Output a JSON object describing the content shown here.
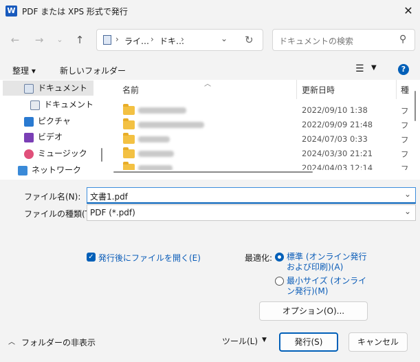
{
  "window": {
    "title": "PDF または XPS 形式で発行",
    "app_icon": "W"
  },
  "nav": {
    "breadcrumb": [
      "ライ…",
      "ドキ…"
    ],
    "search_placeholder": "ドキュメントの検索"
  },
  "toolbar": {
    "organize": "整理 ▾",
    "new_folder": "新しいフォルダー"
  },
  "sidebar": {
    "items": [
      {
        "label": "ドキュメント",
        "icon": "document-icon"
      },
      {
        "label": "ドキュメント",
        "icon": "document-icon"
      },
      {
        "label": "ピクチャ",
        "icon": "pictures-icon"
      },
      {
        "label": "ビデオ",
        "icon": "video-icon"
      },
      {
        "label": "ミュージック",
        "icon": "music-icon"
      },
      {
        "label": "ネットワーク",
        "icon": "network-icon"
      }
    ]
  },
  "filelist": {
    "columns": [
      "名前",
      "更新日時",
      "種"
    ],
    "rows": [
      {
        "date": "2022/09/10 1:38",
        "type": "フ"
      },
      {
        "date": "2022/09/09 21:48",
        "type": "フ"
      },
      {
        "date": "2024/07/03 0:33",
        "type": "フ"
      },
      {
        "date": "2024/03/30 21:21",
        "type": "フ"
      },
      {
        "date": "2024/04/03 12:14",
        "type": "フ"
      }
    ]
  },
  "form": {
    "filename_label": "ファイル名(N):",
    "filename_value": "文書1.pdf",
    "filetype_label": "ファイルの種類(T):",
    "filetype_value": "PDF (*.pdf)"
  },
  "options": {
    "open_after": "発行後にファイルを開く(E)",
    "optimize_label": "最適化:",
    "standard": "標準 (オンライン発行および印刷)(A)",
    "minimum": "最小サイズ (オンライン発行)(M)",
    "options_button": "オプション(O)..."
  },
  "footer": {
    "hide_folders": "フォルダーの非表示",
    "tools": "ツール(L)",
    "publish": "発行(S)",
    "cancel": "キャンセル"
  },
  "colors": {
    "accent": "#005fb8",
    "folder": "#f3c143"
  }
}
